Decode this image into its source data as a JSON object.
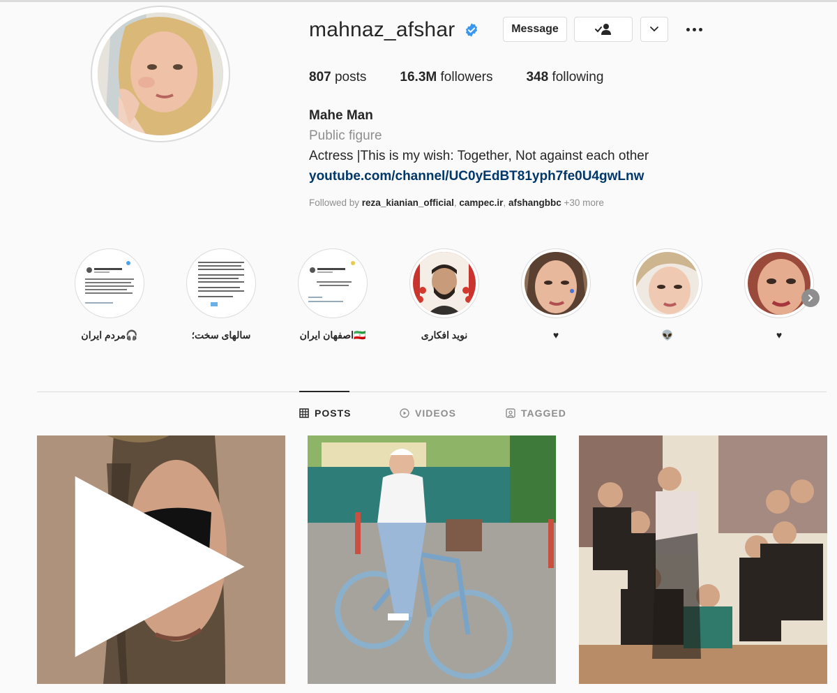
{
  "profile": {
    "username": "mahnaz_afshar",
    "full_name": "Mahe Man",
    "category": "Public figure",
    "bio": "Actress |This is my wish: Together, Not against each other",
    "link": "youtube.com/channel/UC0yEdBT81yph7fe0U4gwLnw",
    "verified": true
  },
  "actions": {
    "message_label": "Message",
    "follow_icon": "person-check-icon",
    "dropdown_icon": "chevron-down-icon",
    "more_icon": "more-horizontal-icon"
  },
  "stats": {
    "posts_count": "807",
    "posts_label": " posts",
    "followers_count": "16.3M",
    "followers_label": " followers",
    "following_count": "348",
    "following_label": " following"
  },
  "followed_by": {
    "prefix": "Followed by ",
    "user1": "reza_kianian_official",
    "sep1": ", ",
    "user2": "campec.ir",
    "sep2": ", ",
    "user3": "afshangbbc",
    "more": " +30 more"
  },
  "highlights": [
    {
      "label": "مردم ایران🎧"
    },
    {
      "label": "سالهای سخت؛"
    },
    {
      "label": "اصفهان ایران🇮🇷"
    },
    {
      "label": "نوید افکاری"
    },
    {
      "label": "♥"
    },
    {
      "label": "👽"
    },
    {
      "label": "♥"
    }
  ],
  "tabs": {
    "posts": "POSTS",
    "videos": "VIDEOS",
    "tagged": "TAGGED"
  },
  "colors": {
    "verified": "#3897f0",
    "link": "#00376b",
    "muted": "#8e8e8e",
    "text": "#262626"
  }
}
